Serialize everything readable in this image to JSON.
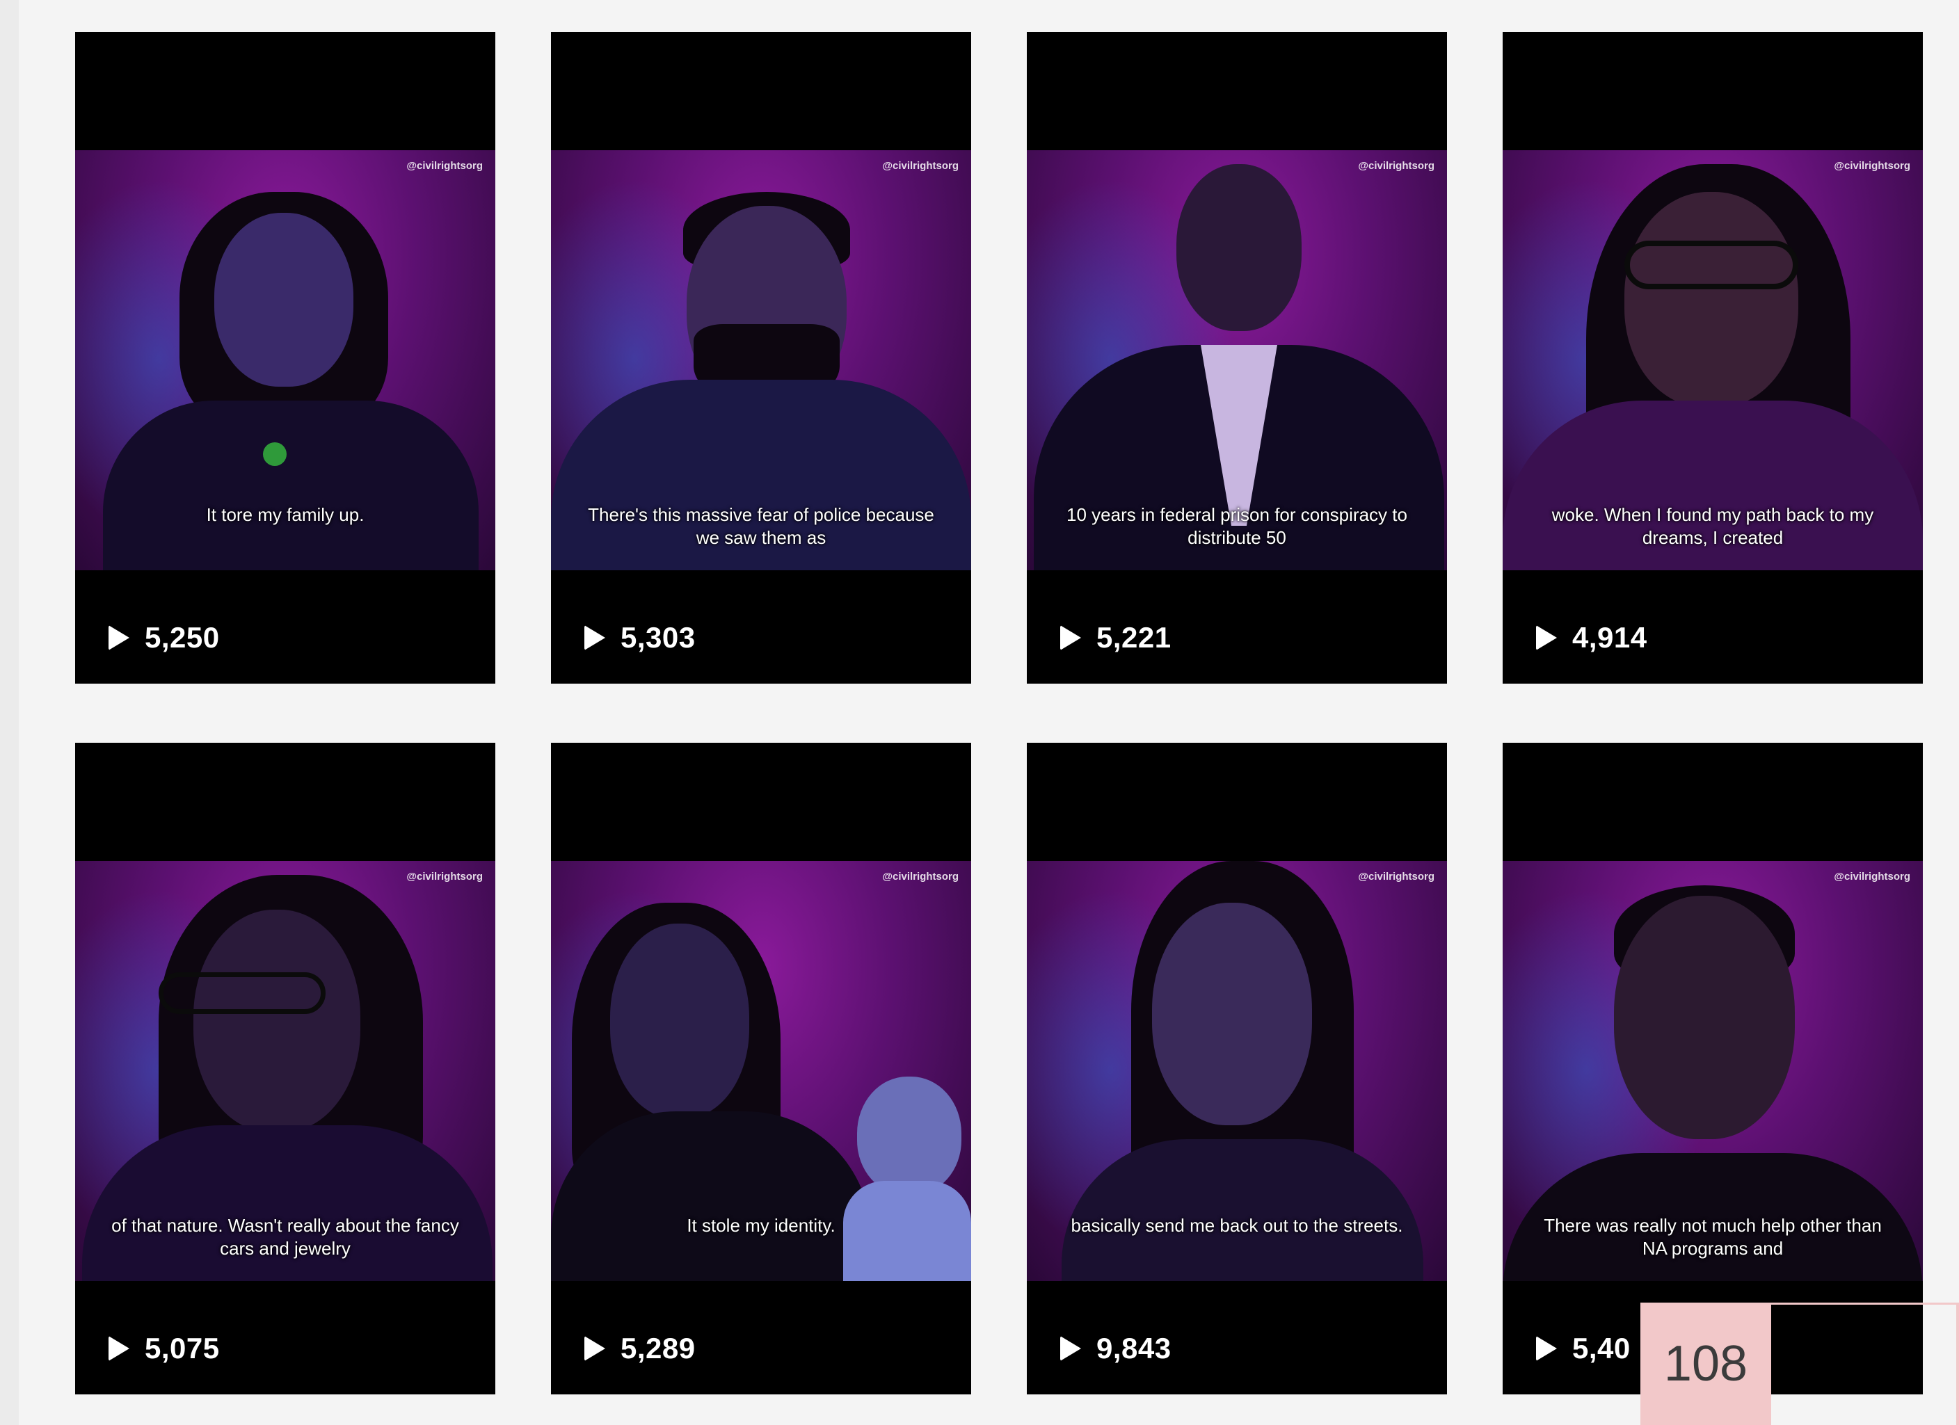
{
  "handle": "@civilrightsorg",
  "videos": [
    {
      "caption": "It tore my family up.",
      "views": "5,250"
    },
    {
      "caption": "There's this massive fear of police because we saw them as",
      "views": "5,303"
    },
    {
      "caption": "10 years in federal prison for conspiracy to distribute 50",
      "views": "5,221"
    },
    {
      "caption": "woke. When I found my path back to my dreams, I created",
      "views": "4,914"
    },
    {
      "caption": "of that nature. Wasn't really about the fancy cars and jewelry",
      "views": "5,075"
    },
    {
      "caption": "It stole my identity.",
      "views": "5,289"
    },
    {
      "caption": "basically send me back out to the streets.",
      "views": "9,843"
    },
    {
      "caption": "There was really not much help other than NA programs and",
      "views": "5,40"
    }
  ],
  "page_number": "108",
  "colors": {
    "tile_bg": "#000000",
    "purple": "#5b1070",
    "badge": "#f2c8c9"
  }
}
